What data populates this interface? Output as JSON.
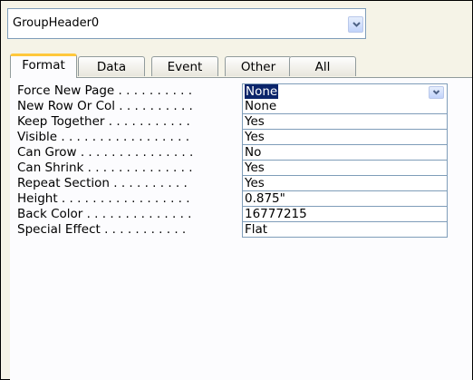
{
  "object_selector": {
    "value": "GroupHeader0"
  },
  "tabs": [
    {
      "label": "Format",
      "active": true
    },
    {
      "label": "Data",
      "active": false
    },
    {
      "label": "Event",
      "active": false
    },
    {
      "label": "Other",
      "active": false
    },
    {
      "label": "All",
      "active": false
    }
  ],
  "properties": [
    {
      "label": "Force New Page . . . . . . . . . .",
      "value": "None"
    },
    {
      "label": "New Row Or Col . . . . . . . . . .",
      "value": "None"
    },
    {
      "label": "Keep Together . . . . . . . . . . .",
      "value": "Yes"
    },
    {
      "label": "Visible . . . . . . . . . . . . . . . . .",
      "value": "Yes"
    },
    {
      "label": "Can Grow . . . . . . . . . . . . . . .",
      "value": "No"
    },
    {
      "label": "Can Shrink . . . . . . . . . . . . . .",
      "value": "Yes"
    },
    {
      "label": "Repeat Section . . . . . . . . . .",
      "value": "Yes"
    },
    {
      "label": "Height . . . . . . . . . . . . . . . . .",
      "value": "0.875\""
    },
    {
      "label": "Back Color . . . . . . . . . . . . . .",
      "value": "16777215"
    },
    {
      "label": "Special Effect . . . . . . . . . . .",
      "value": "Flat"
    }
  ],
  "icons": {
    "combo_button": "chevron-down-icon",
    "row_dropdown": "chevron-down-icon"
  },
  "colors": {
    "active_tab_accent": "#ffc83c",
    "selection": "#0a246a",
    "field_border": "#7f9db9"
  }
}
